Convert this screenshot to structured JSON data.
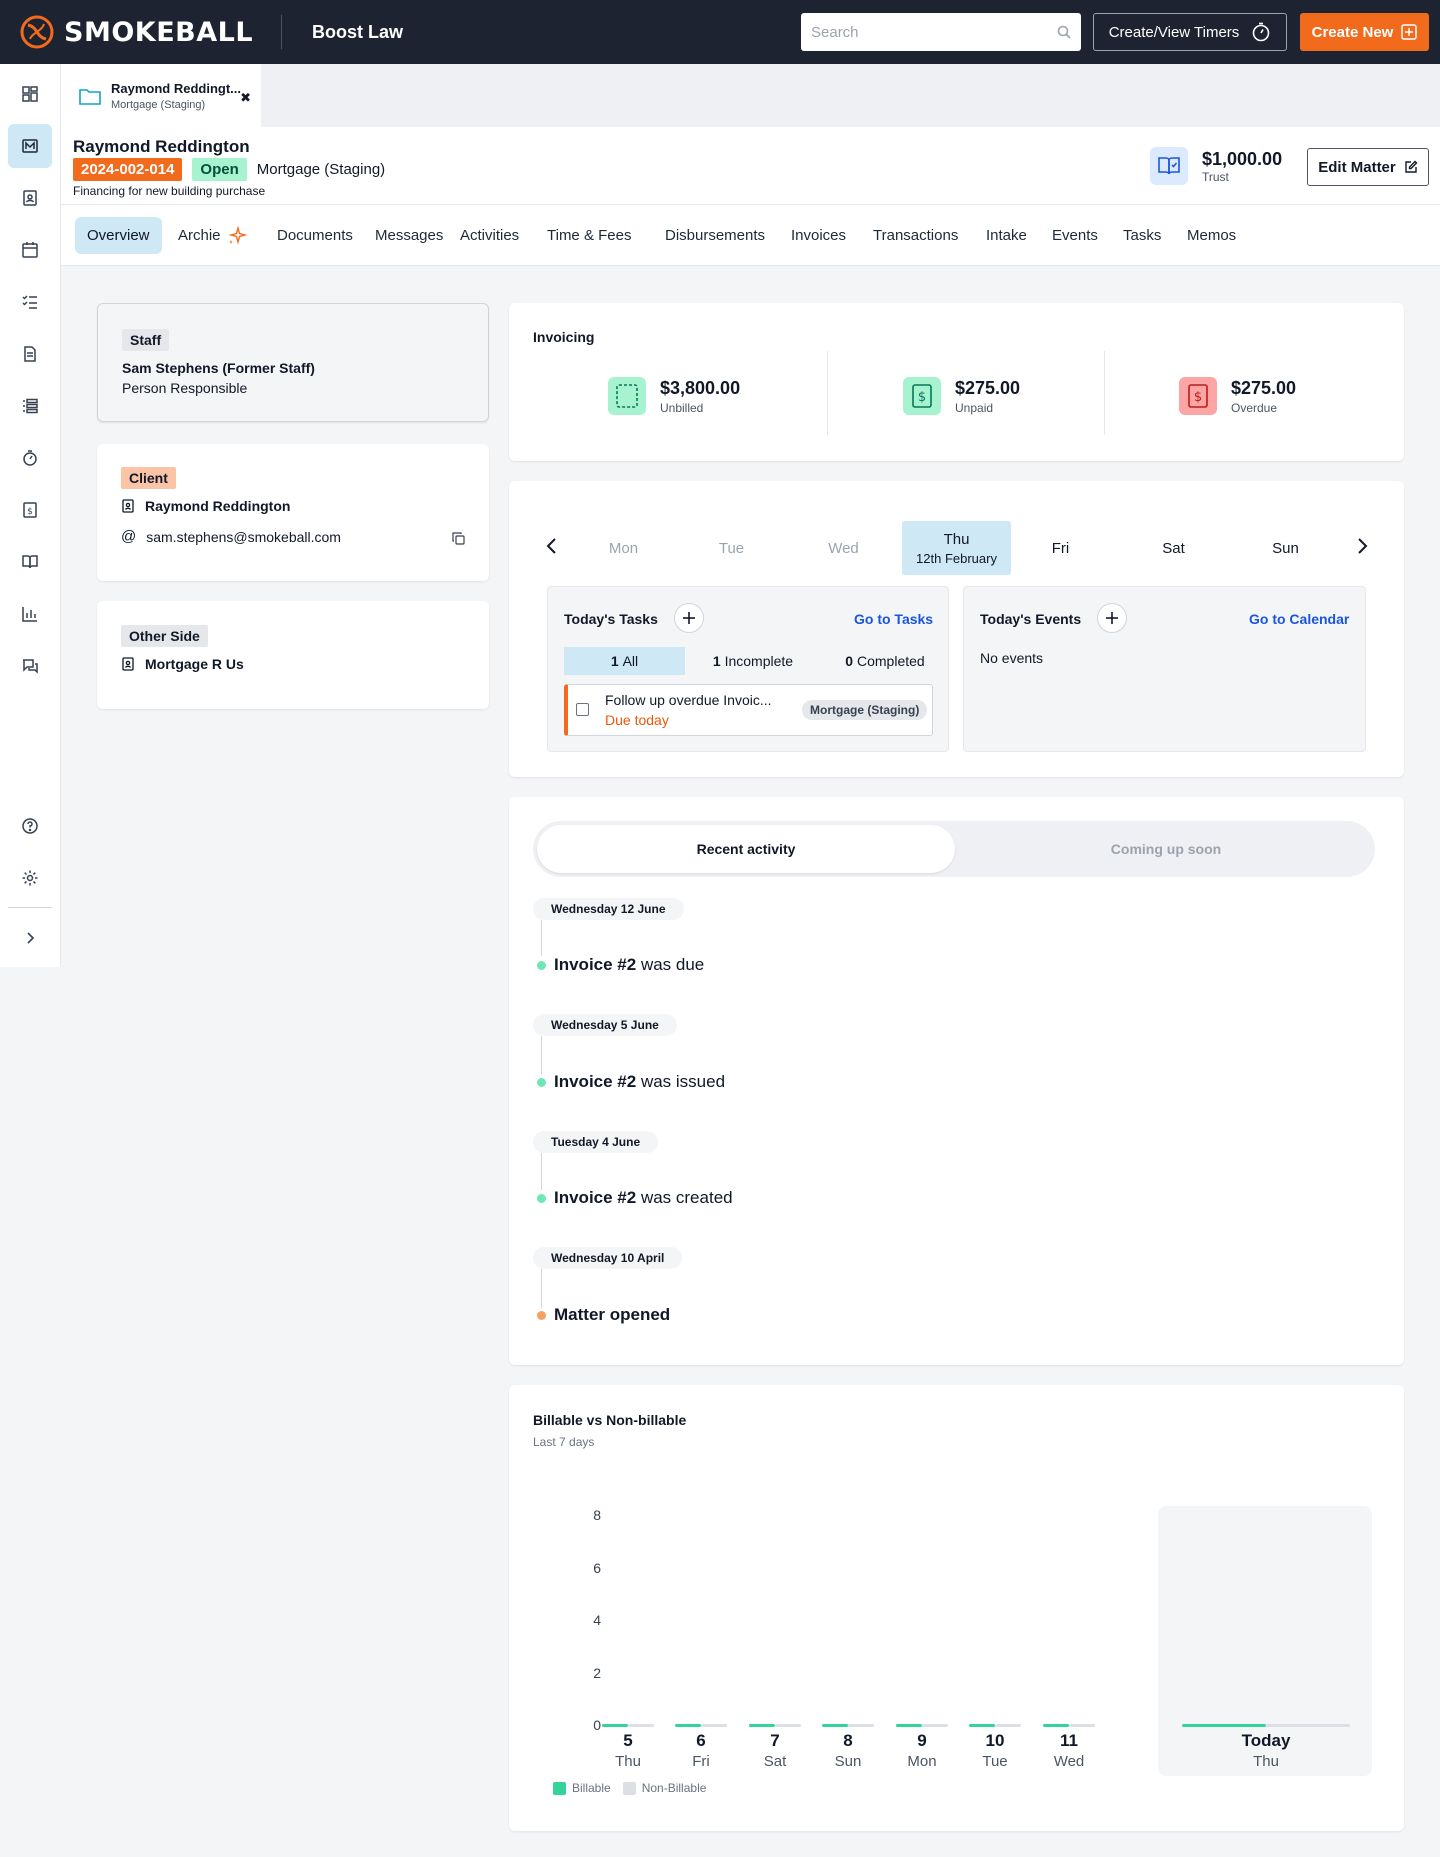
{
  "topbar": {
    "brand": "SMOKEBALL",
    "firm": "Boost Law",
    "search_placeholder": "Search",
    "timers_label": "Create/View Timers",
    "create_label": "Create New"
  },
  "matter_tab": {
    "title": "Raymond Reddingt...",
    "subtitle": "Mortgage (Staging)"
  },
  "matter": {
    "client_name": "Raymond Reddington",
    "number": "2024-002-014",
    "status": "Open",
    "type": "Mortgage (Staging)",
    "description": "Financing for new building purchase",
    "trust_amount": "$1,000.00",
    "trust_label": "Trust",
    "edit_label": "Edit Matter"
  },
  "nav": {
    "tabs": [
      {
        "label": "Overview"
      },
      {
        "label": "Archie"
      },
      {
        "label": "Documents"
      },
      {
        "label": "Messages"
      },
      {
        "label": "Activities"
      },
      {
        "label": "Time & Fees"
      },
      {
        "label": "Disbursements"
      },
      {
        "label": "Invoices"
      },
      {
        "label": "Transactions"
      },
      {
        "label": "Intake"
      },
      {
        "label": "Events"
      },
      {
        "label": "Tasks"
      },
      {
        "label": "Memos"
      }
    ]
  },
  "staff": {
    "tag": "Staff",
    "name": "Sam Stephens (Former Staff)",
    "role": "Person Responsible"
  },
  "client": {
    "tag": "Client",
    "name": "Raymond Reddington",
    "email": "sam.stephens@smokeball.com"
  },
  "other_side": {
    "tag": "Other Side",
    "name": "Mortgage R Us"
  },
  "invoicing": {
    "title": "Invoicing",
    "items": [
      {
        "amount": "$3,800.00",
        "label": "Unbilled"
      },
      {
        "amount": "$275.00",
        "label": "Unpaid"
      },
      {
        "amount": "$275.00",
        "label": "Overdue"
      }
    ]
  },
  "calendar": {
    "days": [
      {
        "label": "Mon"
      },
      {
        "label": "Tue"
      },
      {
        "label": "Wed"
      },
      {
        "label": "Thu",
        "sub": "12th February"
      },
      {
        "label": "Fri"
      },
      {
        "label": "Sat"
      },
      {
        "label": "Sun"
      }
    ]
  },
  "tasks": {
    "title": "Today's Tasks",
    "link": "Go to Tasks",
    "filters": [
      {
        "count": "1",
        "label": "All"
      },
      {
        "count": "1",
        "label": "Incomplete"
      },
      {
        "count": "0",
        "label": "Completed"
      }
    ],
    "item_title": "Follow up overdue Invoic...",
    "item_due": "Due today",
    "item_tag": "Mortgage (Staging)"
  },
  "events": {
    "title": "Today's Events",
    "link": "Go to Calendar",
    "empty": "No events"
  },
  "activity": {
    "tab_recent": "Recent activity",
    "tab_upcoming": "Coming up soon",
    "entries": [
      {
        "date": "Wednesday 12 June",
        "bold": "Invoice #2",
        "rest": " was due"
      },
      {
        "date": "Wednesday 5 June",
        "bold": "Invoice #2",
        "rest": " was issued"
      },
      {
        "date": "Tuesday 4 June",
        "bold": "Invoice #2",
        "rest": " was created"
      },
      {
        "date": "Wednesday 10 April",
        "bold": "Matter opened",
        "rest": ""
      }
    ]
  },
  "colors": {
    "brand_orange": "#f26b1d",
    "accent_blue": "#1a56db",
    "billable_green": "#34d399",
    "nonbillable_gray": "#d1d5db",
    "overdue_red": "#ef4444"
  },
  "chart_data": {
    "type": "bar",
    "title": "Billable vs Non-billable",
    "subtitle": "Last 7 days",
    "categories": [
      "5",
      "6",
      "7",
      "8",
      "9",
      "10",
      "11",
      "Today"
    ],
    "category_days": [
      "Thu",
      "Fri",
      "Sat",
      "Sun",
      "Mon",
      "Tue",
      "Wed",
      "Thu"
    ],
    "series": [
      {
        "name": "Billable",
        "values": [
          0,
          0,
          0,
          0,
          0,
          0,
          0,
          0
        ]
      },
      {
        "name": "Non-Billable",
        "values": [
          0,
          0,
          0,
          0,
          0,
          0,
          0,
          0
        ]
      }
    ],
    "yticks": [
      "0",
      "2",
      "4",
      "6",
      "8"
    ],
    "ylim": [
      0,
      8
    ],
    "legend": "bottom-left"
  }
}
